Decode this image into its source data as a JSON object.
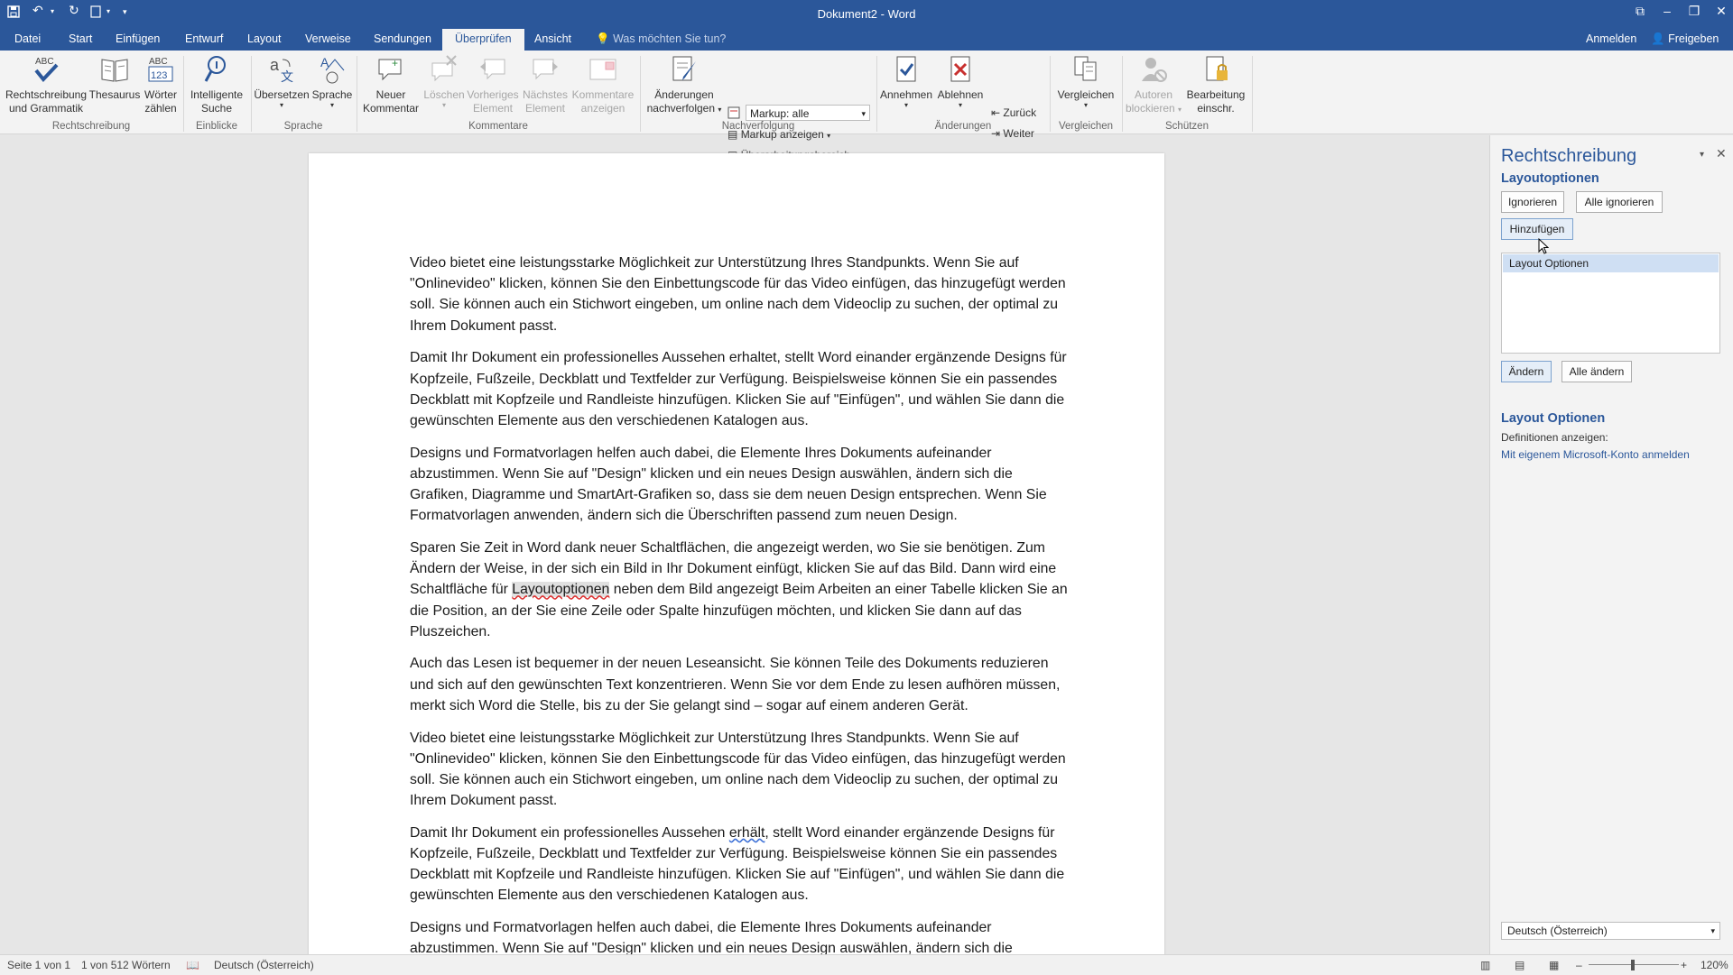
{
  "window": {
    "title": "Dokument2 - Word",
    "quick_access": [
      "save-icon",
      "undo-icon",
      "redo-icon",
      "touch-mode-icon",
      "customize-icon"
    ],
    "controls": [
      "ribbon-display-icon",
      "minimize-icon",
      "restore-icon",
      "close-icon"
    ]
  },
  "tabs": {
    "items": [
      "Datei",
      "Start",
      "Einfügen",
      "Entwurf",
      "Layout",
      "Verweise",
      "Sendungen",
      "Überprüfen",
      "Ansicht"
    ],
    "active": "Überprüfen",
    "tellme": "Was möchten Sie tun?",
    "signin": "Anmelden",
    "share": "Freigeben"
  },
  "ribbon": {
    "spelling": "Rechtschreibung und Grammatik",
    "thesaurus": "Thesaurus",
    "wordcount": "Wörter zählen",
    "smartlookup": "Intelligente Suche",
    "translate": "Übersetzen",
    "language": "Sprache",
    "newcomment": "Neuer Kommentar",
    "delete": "Löschen",
    "previous": "Vorheriges Element",
    "next": "Nächstes Element",
    "showcomments": "Kommentare anzeigen",
    "trackchanges": "Änderungen nachverfolgen",
    "markup_value": "Markup: alle",
    "showmarkup": "Markup anzeigen",
    "reviewpane": "Überarbeitungsbereich",
    "accept": "Annehmen",
    "reject": "Ablehnen",
    "back": "Zurück",
    "forward": "Weiter",
    "compare": "Vergleichen",
    "blockauthors": "Autoren blockieren",
    "restrict": "Bearbeitung einschr.",
    "groups": {
      "proofing": "Rechtschreibung",
      "insights": "Einblicke",
      "language": "Sprache",
      "comments": "Kommentare",
      "tracking": "Nachverfolgung",
      "changes": "Änderungen",
      "compare": "Vergleichen",
      "protect": "Schützen"
    },
    "accent": "#2b579a"
  },
  "document": {
    "paragraphs": [
      {
        "text": "Video bietet eine leistungsstarke Möglichkeit zur Unterstützung Ihres Standpunkts. Wenn Sie auf \"Onlinevideo\" klicken, können Sie den Einbettungscode für das Video einfügen, das hinzugefügt werden soll. Sie können auch ein Stichwort eingeben, um online nach dem Videoclip zu suchen, der optimal zu Ihrem Dokument passt."
      },
      {
        "text": "Damit Ihr Dokument ein professionelles Aussehen erhaltet, stellt Word einander ergänzende Designs für Kopfzeile, Fußzeile, Deckblatt und Textfelder zur Verfügung. Beispielsweise können Sie ein passendes Deckblatt mit Kopfzeile und Randleiste hinzufügen. Klicken Sie auf \"Einfügen\", und wählen Sie dann die gewünschten Elemente aus den verschiedenen Katalogen aus."
      },
      {
        "text": "Designs und Formatvorlagen helfen auch dabei, die Elemente Ihres Dokuments aufeinander abzustimmen. Wenn Sie auf \"Design\" klicken und ein neues Design auswählen, ändern sich die Grafiken, Diagramme und SmartArt-Grafiken so, dass sie dem neuen Design entsprechen. Wenn Sie Formatvorlagen anwenden, ändern sich die Überschriften passend zum neuen Design."
      },
      {
        "pre": "Sparen Sie Zeit in Word dank neuer Schaltflächen, die angezeigt werden, wo Sie sie benötigen. Zum Ändern der Weise, in der sich ein Bild in Ihr Dokument einfügt, klicken Sie auf das Bild. Dann wird eine Schaltfläche für ",
        "flag": "Layoutoptionen",
        "post": " neben dem Bild angezeigt Beim Arbeiten an einer Tabelle klicken Sie an die Position, an der Sie eine Zeile oder Spalte hinzufügen möchten, und klicken Sie dann auf das Pluszeichen."
      },
      {
        "text": "Auch das Lesen ist bequemer in der neuen Leseansicht. Sie können Teile des Dokuments reduzieren und sich auf den gewünschten Text konzentrieren. Wenn Sie vor dem Ende zu lesen aufhören müssen, merkt sich Word die Stelle, bis zu der Sie gelangt sind – sogar auf einem anderen Gerät."
      },
      {
        "text": "Video bietet eine leistungsstarke Möglichkeit zur Unterstützung Ihres Standpunkts. Wenn Sie auf \"Onlinevideo\" klicken, können Sie den Einbettungscode für das Video einfügen, das hinzugefügt werden soll. Sie können auch ein Stichwort eingeben, um online nach dem Videoclip zu suchen, der optimal zu Ihrem Dokument passt."
      },
      {
        "pre": "Damit Ihr Dokument ein professionelles Aussehen ",
        "flag": "erhält",
        "post": ", stellt Word einander ergänzende Designs für Kopfzeile, Fußzeile, Deckblatt und Textfelder zur Verfügung. Beispielsweise können Sie ein passendes Deckblatt mit Kopfzeile und Randleiste hinzufügen. Klicken Sie auf \"Einfügen\", und wählen Sie dann die gewünschten Elemente aus den verschiedenen Katalogen aus."
      },
      {
        "text": "Designs und Formatvorlagen helfen auch dabei, die Elemente Ihres Dokuments aufeinander abzustimmen. Wenn Sie auf \"Design\" klicken und ein neues Design auswählen, ändern sich die"
      }
    ]
  },
  "pane": {
    "title": "Rechtschreibung",
    "word": "Layoutoptionen",
    "ignore": "Ignorieren",
    "ignore_all": "Alle ignorieren",
    "add": "Hinzufügen",
    "suggestion": "Layout Optionen",
    "change": "Ändern",
    "change_all": "Alle ändern",
    "def_title": "Layout Optionen",
    "def_label": "Definitionen anzeigen:",
    "def_link": "Mit eigenem Microsoft-Konto anmelden",
    "language": "Deutsch (Österreich)"
  },
  "status": {
    "page": "Seite 1 von 1",
    "words": "1 von 512 Wörtern",
    "language": "Deutsch (Österreich)",
    "zoom": "120%"
  }
}
